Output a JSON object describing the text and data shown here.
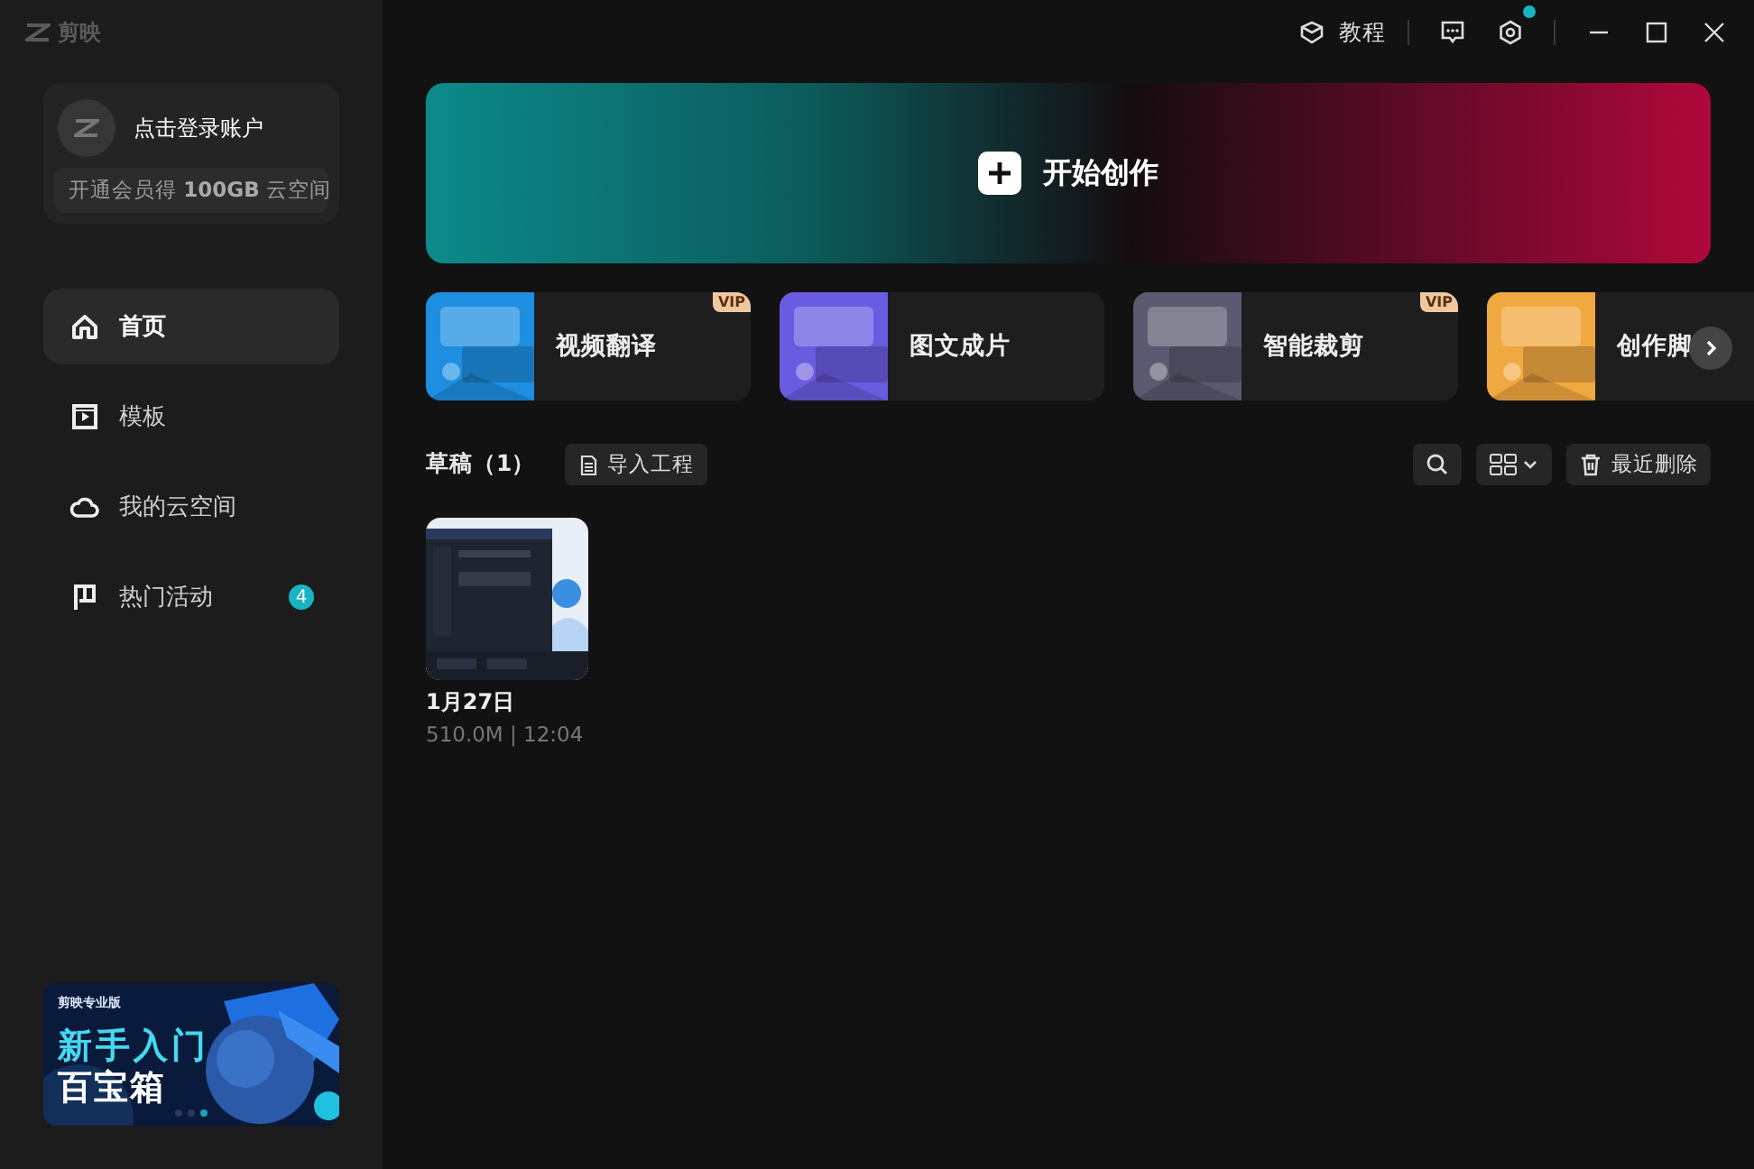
{
  "app": {
    "logo": "剪映"
  },
  "title_bar": {
    "tutorial": "教程",
    "settings_dot": true
  },
  "account": {
    "login": "点击登录账户",
    "promo": "开通会员得 **100GB** 云空间"
  },
  "sidebar": {
    "items": [
      {
        "label": "首页",
        "selected": true
      },
      {
        "label": "模板",
        "selected": false
      },
      {
        "label": "我的云空间",
        "selected": false
      },
      {
        "label": "热门活动",
        "selected": false,
        "badge": "4"
      }
    ],
    "banner": {
      "brand": "剪映专业版",
      "line_1": "新手入门",
      "line_2": "百宝箱"
    }
  },
  "start": {
    "label": "开始创作"
  },
  "features": [
    {
      "label": "视频翻译",
      "badge": "VIP",
      "color": "#1e8fe0"
    },
    {
      "label": "图文成片",
      "color": "#6a5ce0"
    },
    {
      "label": "智能裁剪",
      "badge": "VIP",
      "color": "#5a5a70"
    },
    {
      "label": "创作脚",
      "color": "#f0a840"
    }
  ],
  "drafts": {
    "title": "草稿（1）",
    "import": "导入工程",
    "recent_delete": "最近删除",
    "items": [
      {
        "date": "1月27日",
        "meta": "510.0M | 12:04"
      }
    ]
  }
}
